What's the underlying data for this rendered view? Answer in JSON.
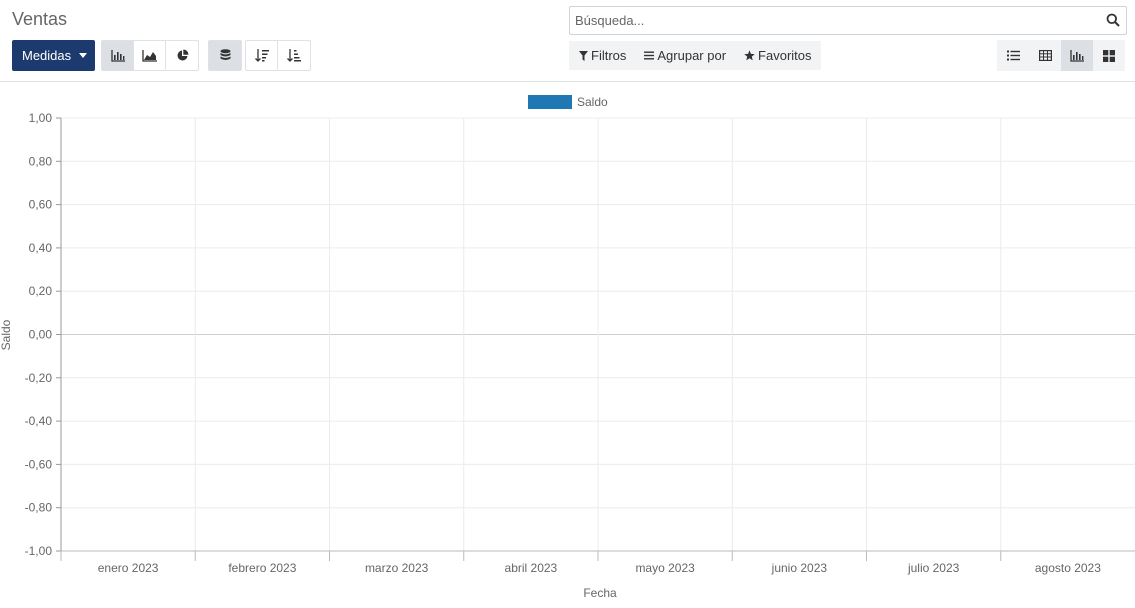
{
  "page": {
    "title": "Ventas"
  },
  "search": {
    "placeholder": "Búsqueda..."
  },
  "toolbar": {
    "measures_label": "Medidas"
  },
  "filters": {
    "filter_label": "Filtros",
    "groupby_label": "Agrupar por",
    "favorites_label": "Favoritos"
  },
  "chart_data": {
    "type": "bar",
    "legend": [
      "Saldo"
    ],
    "series": [
      {
        "name": "Saldo",
        "color": "#1f77b4",
        "values": []
      }
    ],
    "categories": [
      "enero 2023",
      "febrero 2023",
      "marzo 2023",
      "abril 2023",
      "mayo 2023",
      "junio 2023",
      "julio 2023",
      "agosto 2023"
    ],
    "xlabel": "Fecha",
    "ylabel": "Saldo",
    "ylim": [
      -1,
      1
    ],
    "yticks": [
      "1,00",
      "0,80",
      "0,60",
      "0,40",
      "0,20",
      "0,00",
      "-0,20",
      "-0,40",
      "-0,60",
      "-0,80",
      "-1,00"
    ],
    "grid": true,
    "legend_position": "top-center"
  }
}
